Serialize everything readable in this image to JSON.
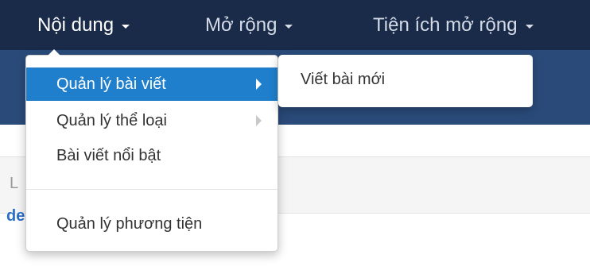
{
  "navbar": {
    "items": [
      {
        "label": "Nội dung"
      },
      {
        "label": "Mở rộng"
      },
      {
        "label": "Tiện ích mở rộng"
      }
    ]
  },
  "dropdown": {
    "items": [
      {
        "label": "Quản lý bài viết",
        "has_submenu": true
      },
      {
        "label": "Quản lý thể loại",
        "has_submenu": true
      },
      {
        "label": "Bài viết nổi bật",
        "has_submenu": false
      },
      {
        "label": "Quản lý phương tiện",
        "has_submenu": false
      }
    ]
  },
  "submenu": {
    "items": [
      {
        "label": "Viết bài mới"
      }
    ]
  },
  "page": {
    "panel_text": "L",
    "link_text": "de"
  }
}
